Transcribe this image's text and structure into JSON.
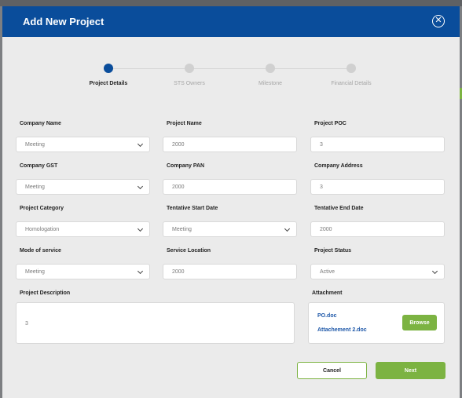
{
  "modal": {
    "title": "Add New Project",
    "close_icon": "close-icon"
  },
  "stepper": {
    "steps": [
      {
        "label": "Project Details",
        "active": true
      },
      {
        "label": "STS Owners",
        "active": false
      },
      {
        "label": "Milestone",
        "active": false
      },
      {
        "label": "Financial Details",
        "active": false
      }
    ]
  },
  "form": {
    "company_name": {
      "label": "Company Name",
      "value": "Meeting"
    },
    "project_name": {
      "label": "Project Name",
      "value": "2000"
    },
    "project_poc": {
      "label": "Project POC",
      "value": "3"
    },
    "company_gst": {
      "label": "Company GST",
      "value": "Meeting"
    },
    "company_pan": {
      "label": "Company PAN",
      "value": "2000"
    },
    "company_address": {
      "label": "Company Address",
      "value": "3"
    },
    "project_category": {
      "label": "Project Category",
      "value": "Homologation"
    },
    "tentative_start_date": {
      "label": "Tentative Start Date",
      "value": "Meeting"
    },
    "tentative_end_date": {
      "label": "Tentative End Date",
      "value": "2000"
    },
    "mode_of_service": {
      "label": "Mode of service",
      "value": "Meeting"
    },
    "service_location": {
      "label": "Service Location",
      "value": "2000"
    },
    "project_status": {
      "label": "Project Status",
      "value": "Active"
    },
    "project_description": {
      "label": "Project Description",
      "value": "3"
    },
    "attachment": {
      "label": "Attachment",
      "files": [
        "PO.doc",
        "Attachement 2.doc"
      ],
      "browse_label": "Browse"
    }
  },
  "footer": {
    "cancel_label": "Cancel",
    "next_label": "Next"
  },
  "colors": {
    "header": "#0a4d9b",
    "accent": "#7cb342",
    "file_link": "#1d57a8"
  }
}
